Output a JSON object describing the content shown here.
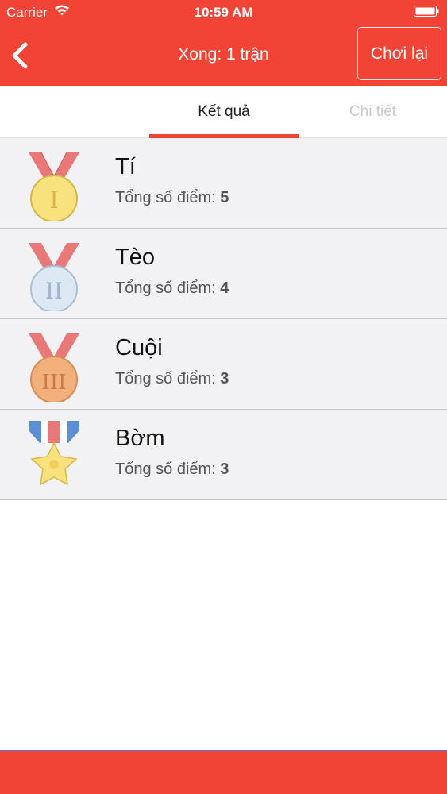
{
  "status_bar": {
    "carrier": "Carrier",
    "time": "10:59 AM"
  },
  "nav": {
    "title": "Xong: 1 trận",
    "replay_label": "Chơi lại",
    "back_icon": "chevron-left-icon"
  },
  "tabs": [
    {
      "label": "Kết quả",
      "active": true
    },
    {
      "label": "Chi tiết",
      "active": false
    }
  ],
  "score_label": "Tổng số điểm:",
  "players": [
    {
      "name": "Tí",
      "score": "5",
      "medal": "gold-medal-icon"
    },
    {
      "name": "Tèo",
      "score": "4",
      "medal": "silver-medal-icon"
    },
    {
      "name": "Cuội",
      "score": "3",
      "medal": "bronze-medal-icon"
    },
    {
      "name": "Bờm",
      "score": "3",
      "medal": "star-medal-icon"
    }
  ],
  "colors": {
    "accent": "#f24436",
    "row_background": "#f2f2f4",
    "inactive_tab": "#c9c9c9"
  }
}
